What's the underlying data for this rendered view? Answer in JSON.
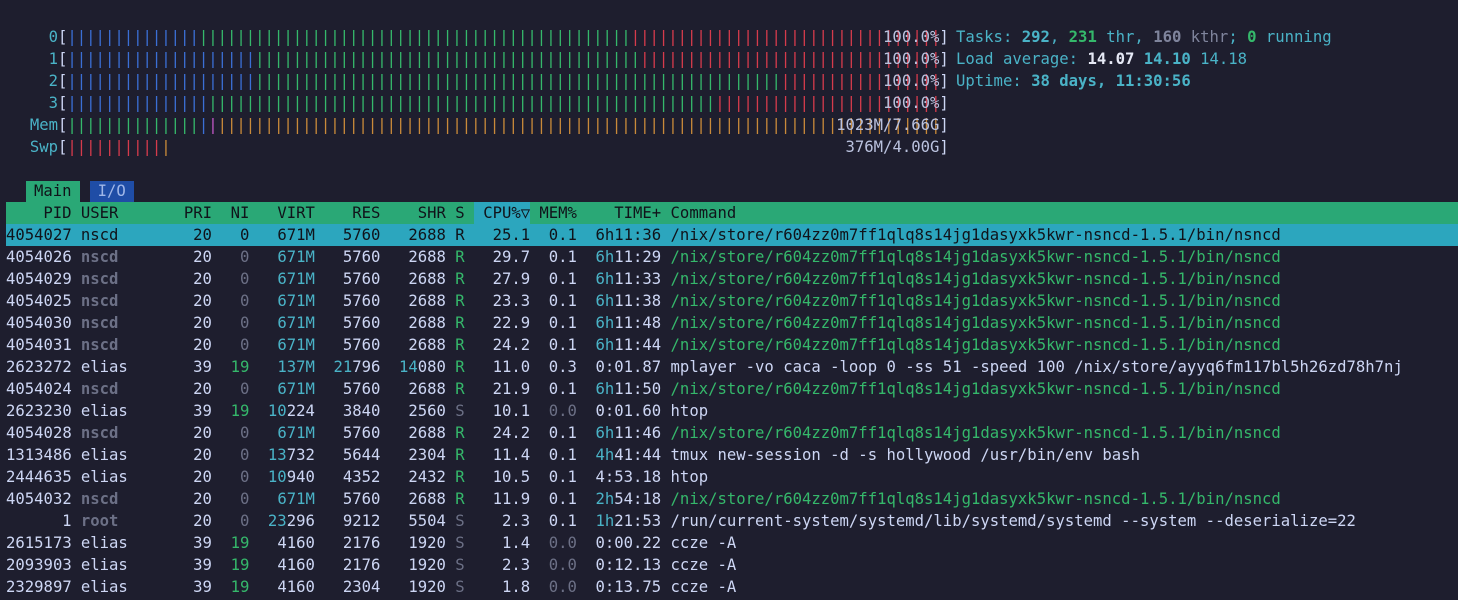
{
  "cpu_meters": [
    {
      "label": "0",
      "value": "100.0%",
      "blue": 14,
      "green": 46,
      "red": 41
    },
    {
      "label": "1",
      "value": "100.0%",
      "blue": 20,
      "green": 41,
      "red": 40
    },
    {
      "label": "2",
      "value": "100.0%",
      "blue": 20,
      "green": 56,
      "red": 25
    },
    {
      "label": "3",
      "value": "100.0%",
      "blue": 15,
      "green": 54,
      "red": 32
    }
  ],
  "mem_meter": {
    "label": "Mem",
    "value": "1023M/7.66G",
    "green": 14,
    "blue": 1,
    "magenta": 1,
    "orange": 77
  },
  "swp_meter": {
    "label": "Swp",
    "value": "376M/4.00G",
    "red": 10,
    "orange": 1
  },
  "info": {
    "tasks_label": "Tasks: ",
    "tasks": "292",
    "sep1": ", ",
    "thr": "231",
    "thr_label": " thr",
    "sep2": ", ",
    "kthr": "160",
    "kthr_label": " kthr",
    "sep3": "; ",
    "running": "0",
    "running_label": " running",
    "load_label": "Load average: ",
    "load1": "14.07",
    "load5": "14.10",
    "load15": "14.18",
    "uptime_label": "Uptime: ",
    "uptime": "38 days, 11:30:56"
  },
  "tabs": {
    "main": "Main",
    "io": "I/O"
  },
  "columns": {
    "pid": "PID",
    "user": "USER",
    "pri": "PRI",
    "ni": "NI",
    "virt": "VIRT",
    "res": "RES",
    "shr": "SHR",
    "s": "S",
    "cpu": "CPU%▽",
    "mem": "MEM%",
    "time": "TIME+",
    "command": "Command"
  },
  "processes": [
    {
      "pid": "4054027",
      "user": "nscd",
      "pri": "20",
      "ni": "0",
      "virt": "671M",
      "res": "5760",
      "shr": "2688",
      "s": "R",
      "cpu": "25.1",
      "mem": "0.1",
      "time_h": "6h",
      "time_m": "11:36",
      "command": "/nix/store/r604zz0m7ff1qlq8s14jg1dasyxk5kwr-nsncd-1.5.1/bin/nsncd",
      "selected": true,
      "thread": false
    },
    {
      "pid": "4054026",
      "user": "nscd",
      "pri": "20",
      "ni": "0",
      "virt": "671M",
      "res": "5760",
      "shr": "2688",
      "s": "R",
      "cpu": "29.7",
      "mem": "0.1",
      "time_h": "6h",
      "time_m": "11:29",
      "command": "/nix/store/r604zz0m7ff1qlq8s14jg1dasyxk5kwr-nsncd-1.5.1/bin/nsncd",
      "thread": true
    },
    {
      "pid": "4054029",
      "user": "nscd",
      "pri": "20",
      "ni": "0",
      "virt": "671M",
      "res": "5760",
      "shr": "2688",
      "s": "R",
      "cpu": "27.9",
      "mem": "0.1",
      "time_h": "6h",
      "time_m": "11:33",
      "command": "/nix/store/r604zz0m7ff1qlq8s14jg1dasyxk5kwr-nsncd-1.5.1/bin/nsncd",
      "thread": true
    },
    {
      "pid": "4054025",
      "user": "nscd",
      "pri": "20",
      "ni": "0",
      "virt": "671M",
      "res": "5760",
      "shr": "2688",
      "s": "R",
      "cpu": "23.3",
      "mem": "0.1",
      "time_h": "6h",
      "time_m": "11:38",
      "command": "/nix/store/r604zz0m7ff1qlq8s14jg1dasyxk5kwr-nsncd-1.5.1/bin/nsncd",
      "thread": true
    },
    {
      "pid": "4054030",
      "user": "nscd",
      "pri": "20",
      "ni": "0",
      "virt": "671M",
      "res": "5760",
      "shr": "2688",
      "s": "R",
      "cpu": "22.9",
      "mem": "0.1",
      "time_h": "6h",
      "time_m": "11:48",
      "command": "/nix/store/r604zz0m7ff1qlq8s14jg1dasyxk5kwr-nsncd-1.5.1/bin/nsncd",
      "thread": true
    },
    {
      "pid": "4054031",
      "user": "nscd",
      "pri": "20",
      "ni": "0",
      "virt": "671M",
      "res": "5760",
      "shr": "2688",
      "s": "R",
      "cpu": "24.2",
      "mem": "0.1",
      "time_h": "6h",
      "time_m": "11:44",
      "command": "/nix/store/r604zz0m7ff1qlq8s14jg1dasyxk5kwr-nsncd-1.5.1/bin/nsncd",
      "thread": true
    },
    {
      "pid": "2623272",
      "user": "elias",
      "pri": "39",
      "ni": "19",
      "virt": "137M",
      "res": "21796",
      "shr": "14080",
      "s": "R",
      "cpu": "11.0",
      "mem": "0.3",
      "time_h": "",
      "time_m": "0:01.87",
      "command": "mplayer -vo caca -loop 0 -ss 51 -speed 100 /nix/store/ayyq6fm117bl5h26zd78h7nj",
      "thread": false
    },
    {
      "pid": "4054024",
      "user": "nscd",
      "pri": "20",
      "ni": "0",
      "virt": "671M",
      "res": "5760",
      "shr": "2688",
      "s": "R",
      "cpu": "21.9",
      "mem": "0.1",
      "time_h": "6h",
      "time_m": "11:50",
      "command": "/nix/store/r604zz0m7ff1qlq8s14jg1dasyxk5kwr-nsncd-1.5.1/bin/nsncd",
      "thread": true
    },
    {
      "pid": "2623230",
      "user": "elias",
      "pri": "39",
      "ni": "19",
      "virt": "10224",
      "res": "3840",
      "shr": "2560",
      "s": "S",
      "cpu": "10.1",
      "mem": "0.0",
      "time_h": "",
      "time_m": "0:01.60",
      "command": "htop",
      "thread": false
    },
    {
      "pid": "4054028",
      "user": "nscd",
      "pri": "20",
      "ni": "0",
      "virt": "671M",
      "res": "5760",
      "shr": "2688",
      "s": "R",
      "cpu": "24.2",
      "mem": "0.1",
      "time_h": "6h",
      "time_m": "11:46",
      "command": "/nix/store/r604zz0m7ff1qlq8s14jg1dasyxk5kwr-nsncd-1.5.1/bin/nsncd",
      "thread": true
    },
    {
      "pid": "1313486",
      "user": "elias",
      "pri": "20",
      "ni": "0",
      "virt": "13732",
      "res": "5644",
      "shr": "2304",
      "s": "R",
      "cpu": "11.4",
      "mem": "0.1",
      "time_h": "4h",
      "time_m": "41:44",
      "command": "tmux new-session -d -s hollywood /usr/bin/env bash",
      "thread": false
    },
    {
      "pid": "2444635",
      "user": "elias",
      "pri": "20",
      "ni": "0",
      "virt": "10940",
      "res": "4352",
      "shr": "2432",
      "s": "R",
      "cpu": "10.5",
      "mem": "0.1",
      "time_h": "",
      "time_m": "4:53.18",
      "command": "htop",
      "thread": false
    },
    {
      "pid": "4054032",
      "user": "nscd",
      "pri": "20",
      "ni": "0",
      "virt": "671M",
      "res": "5760",
      "shr": "2688",
      "s": "R",
      "cpu": "11.9",
      "mem": "0.1",
      "time_h": "2h",
      "time_m": "54:18",
      "command": "/nix/store/r604zz0m7ff1qlq8s14jg1dasyxk5kwr-nsncd-1.5.1/bin/nsncd",
      "thread": true
    },
    {
      "pid": "1",
      "user": "root",
      "pri": "20",
      "ni": "0",
      "virt": "23296",
      "res": "9212",
      "shr": "5504",
      "s": "S",
      "cpu": "2.3",
      "mem": "0.1",
      "time_h": "1h",
      "time_m": "21:53",
      "command": "/run/current-system/systemd/lib/systemd/systemd --system --deserialize=22",
      "thread": false
    },
    {
      "pid": "2615173",
      "user": "elias",
      "pri": "39",
      "ni": "19",
      "virt": "4160",
      "res": "2176",
      "shr": "1920",
      "s": "S",
      "cpu": "1.4",
      "mem": "0.0",
      "time_h": "",
      "time_m": "0:00.22",
      "command": "ccze -A",
      "thread": false
    },
    {
      "pid": "2093903",
      "user": "elias",
      "pri": "39",
      "ni": "19",
      "virt": "4160",
      "res": "2176",
      "shr": "1920",
      "s": "S",
      "cpu": "2.3",
      "mem": "0.0",
      "time_h": "",
      "time_m": "0:12.13",
      "command": "ccze -A",
      "thread": false
    },
    {
      "pid": "2329897",
      "user": "elias",
      "pri": "39",
      "ni": "19",
      "virt": "4160",
      "res": "2304",
      "shr": "1920",
      "s": "S",
      "cpu": "1.8",
      "mem": "0.0",
      "time_h": "",
      "time_m": "0:13.75",
      "command": "ccze -A",
      "thread": false
    }
  ]
}
